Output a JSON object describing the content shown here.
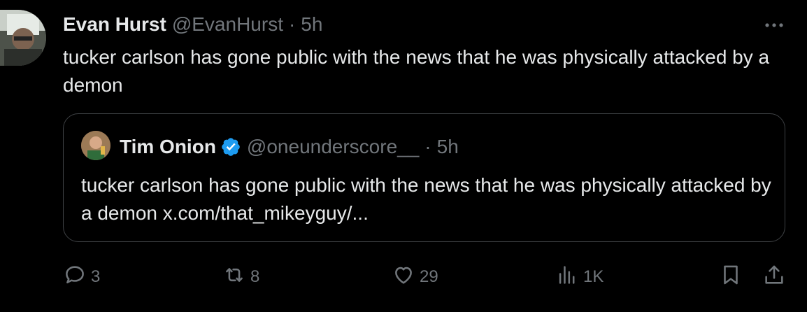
{
  "tweet": {
    "author": {
      "display_name": "Evan Hurst",
      "handle": "@EvanHurst",
      "separator": "·",
      "time": "5h"
    },
    "text": "tucker carlson has gone public with the news that he was physically attacked by a demon"
  },
  "quote": {
    "author": {
      "display_name": "Tim Onion",
      "handle": "@oneunderscore__",
      "separator": "·",
      "time": "5h"
    },
    "text": "tucker carlson has gone public with the news that he was physically attacked by a demon x.com/that_mikeyguy/..."
  },
  "actions": {
    "replies": "3",
    "reposts": "8",
    "likes": "29",
    "views": "1K"
  },
  "icons": {
    "more": "more-dots-icon",
    "reply": "reply-bubble-icon",
    "repost": "repost-arrows-icon",
    "like": "heart-icon",
    "views": "views-bars-icon",
    "bookmark": "bookmark-icon",
    "share": "share-upload-icon",
    "verified": "verified-badge-icon"
  },
  "colors": {
    "background": "#000000",
    "text": "#e7e9ea",
    "muted": "#71767b",
    "border": "#3e4144",
    "verified": "#1d9bf0"
  }
}
